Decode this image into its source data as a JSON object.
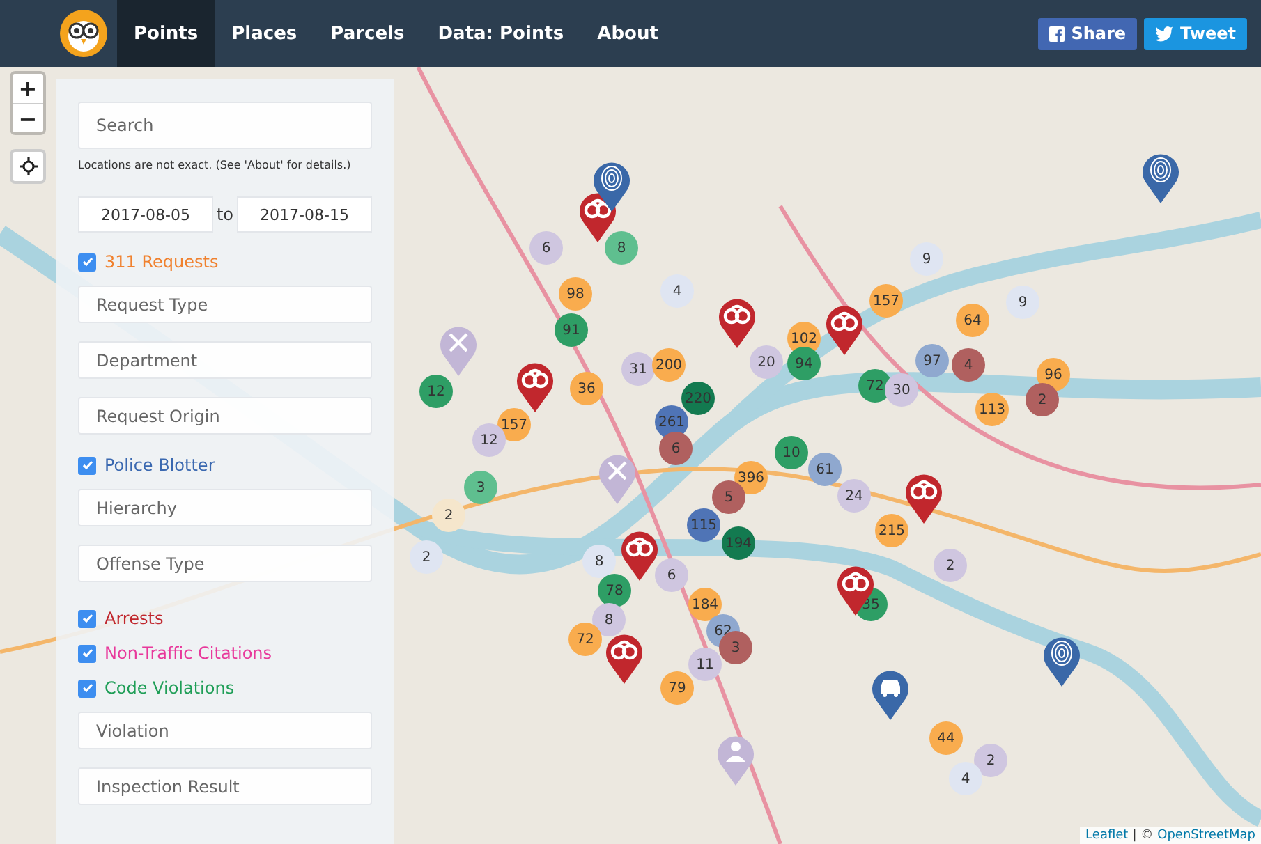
{
  "nav": {
    "tabs": [
      {
        "label": "Points",
        "selected": true
      },
      {
        "label": "Places",
        "selected": false
      },
      {
        "label": "Parcels",
        "selected": false
      },
      {
        "label": "Data: Points",
        "selected": false
      },
      {
        "label": "About",
        "selected": false
      }
    ],
    "share_buttons": [
      {
        "label": "Share",
        "kind": "facebook"
      },
      {
        "label": "Tweet",
        "kind": "twitter"
      }
    ]
  },
  "map_controls": {
    "zoom": [
      "+",
      "−"
    ]
  },
  "sidebar": {
    "search": {
      "placeholder": "Search"
    },
    "note": "Locations are not exact. (See 'About' for details.)",
    "date_range": {
      "start": "2017-08-05",
      "separator": "to",
      "end": "2017-08-15"
    },
    "items": [
      {
        "kind": "checkbox",
        "label": "311 Requests",
        "checked": true,
        "color": "#f0812e"
      },
      {
        "kind": "select",
        "placeholder": "Request Type"
      },
      {
        "kind": "select",
        "placeholder": "Department"
      },
      {
        "kind": "select",
        "placeholder": "Request Origin"
      },
      {
        "kind": "checkbox",
        "label": "Police Blotter",
        "checked": true,
        "color": "#3a68b0"
      },
      {
        "kind": "select",
        "placeholder": "Hierarchy"
      },
      {
        "kind": "select",
        "placeholder": "Offense Type"
      },
      {
        "kind": "checkbox",
        "label": "Arrests",
        "checked": true,
        "color": "#c0272d"
      },
      {
        "kind": "checkbox",
        "label": "Non-Traffic Citations",
        "checked": true,
        "color": "#e8389b"
      },
      {
        "kind": "checkbox",
        "label": "Code Violations",
        "checked": true,
        "color": "#1f9e57"
      },
      {
        "kind": "select",
        "placeholder": "Violation"
      },
      {
        "kind": "select",
        "placeholder": "Inspection Result"
      }
    ]
  },
  "map": {
    "clusters": [
      {
        "count": "8",
        "color": "#5fbf8f"
      },
      {
        "count": "6",
        "color": "#cfc6e0"
      },
      {
        "count": "98",
        "color": "#f9ac4e"
      },
      {
        "count": "91",
        "color": "#2e9e65"
      },
      {
        "count": "4",
        "color": "#dfe5f2"
      },
      {
        "count": "36",
        "color": "#f9ac4e"
      },
      {
        "count": "31",
        "color": "#cfc6e0"
      },
      {
        "count": "200",
        "color": "#f9ac4e"
      },
      {
        "count": "12",
        "color": "#2e9e65"
      },
      {
        "count": "157",
        "color": "#f9ac4e"
      },
      {
        "count": "12",
        "color": "#cfc6e0"
      },
      {
        "count": "220",
        "color": "#137a50"
      },
      {
        "count": "261",
        "color": "#4f74b6"
      },
      {
        "count": "6",
        "color": "#b0605f"
      },
      {
        "count": "102",
        "color": "#f9ac4e"
      },
      {
        "count": "20",
        "color": "#cfc6e0"
      },
      {
        "count": "94",
        "color": "#2e9e65"
      },
      {
        "count": "157",
        "color": "#f9ac4e"
      },
      {
        "count": "9",
        "color": "#dfe5f2"
      },
      {
        "count": "9",
        "color": "#dfe5f2"
      },
      {
        "count": "64",
        "color": "#f9ac4e"
      },
      {
        "count": "97",
        "color": "#8fa8cf"
      },
      {
        "count": "4",
        "color": "#b0605f"
      },
      {
        "count": "72",
        "color": "#2e9e65"
      },
      {
        "count": "30",
        "color": "#cfc6e0"
      },
      {
        "count": "113",
        "color": "#f9ac4e"
      },
      {
        "count": "96",
        "color": "#f9ac4e"
      },
      {
        "count": "2",
        "color": "#b0605f"
      },
      {
        "count": "10",
        "color": "#2e9e65"
      },
      {
        "count": "396",
        "color": "#f9ac4e"
      },
      {
        "count": "61",
        "color": "#8fa8cf"
      },
      {
        "count": "24",
        "color": "#cfc6e0"
      },
      {
        "count": "5",
        "color": "#b0605f"
      },
      {
        "count": "115",
        "color": "#4f74b6"
      },
      {
        "count": "194",
        "color": "#137a50"
      },
      {
        "count": "3",
        "color": "#5fbf8f"
      },
      {
        "count": "2",
        "color": "#f5e6cc"
      },
      {
        "count": "2",
        "color": "#dfe5f2"
      },
      {
        "count": "8",
        "color": "#dfe5f2"
      },
      {
        "count": "6",
        "color": "#cfc6e0"
      },
      {
        "count": "78",
        "color": "#2e9e65"
      },
      {
        "count": "8",
        "color": "#cfc6e0"
      },
      {
        "count": "72",
        "color": "#f9ac4e"
      },
      {
        "count": "184",
        "color": "#f9ac4e"
      },
      {
        "count": "62",
        "color": "#8fa8cf"
      },
      {
        "count": "3",
        "color": "#b0605f"
      },
      {
        "count": "11",
        "color": "#cfc6e0"
      },
      {
        "count": "79",
        "color": "#f9ac4e"
      },
      {
        "count": "215",
        "color": "#f9ac4e"
      },
      {
        "count": "35",
        "color": "#2e9e65"
      },
      {
        "count": "2",
        "color": "#cfc6e0"
      },
      {
        "count": "44",
        "color": "#f9ac4e"
      },
      {
        "count": "2",
        "color": "#cfc6e0"
      },
      {
        "count": "4",
        "color": "#dfe5f2"
      }
    ],
    "pins": [
      {
        "kind": "arrest"
      },
      {
        "kind": "arrest"
      },
      {
        "kind": "arrest"
      },
      {
        "kind": "arrest"
      },
      {
        "kind": "arrest"
      },
      {
        "kind": "arrest"
      },
      {
        "kind": "arrest"
      },
      {
        "kind": "arrest"
      },
      {
        "kind": "fingerprint"
      },
      {
        "kind": "fingerprint"
      },
      {
        "kind": "fingerprint"
      },
      {
        "kind": "tools"
      },
      {
        "kind": "tools"
      },
      {
        "kind": "car"
      },
      {
        "kind": "person"
      }
    ],
    "attribution": {
      "link": "Leaflet",
      "separator": "| ©",
      "source": "OpenStreetMap"
    }
  }
}
